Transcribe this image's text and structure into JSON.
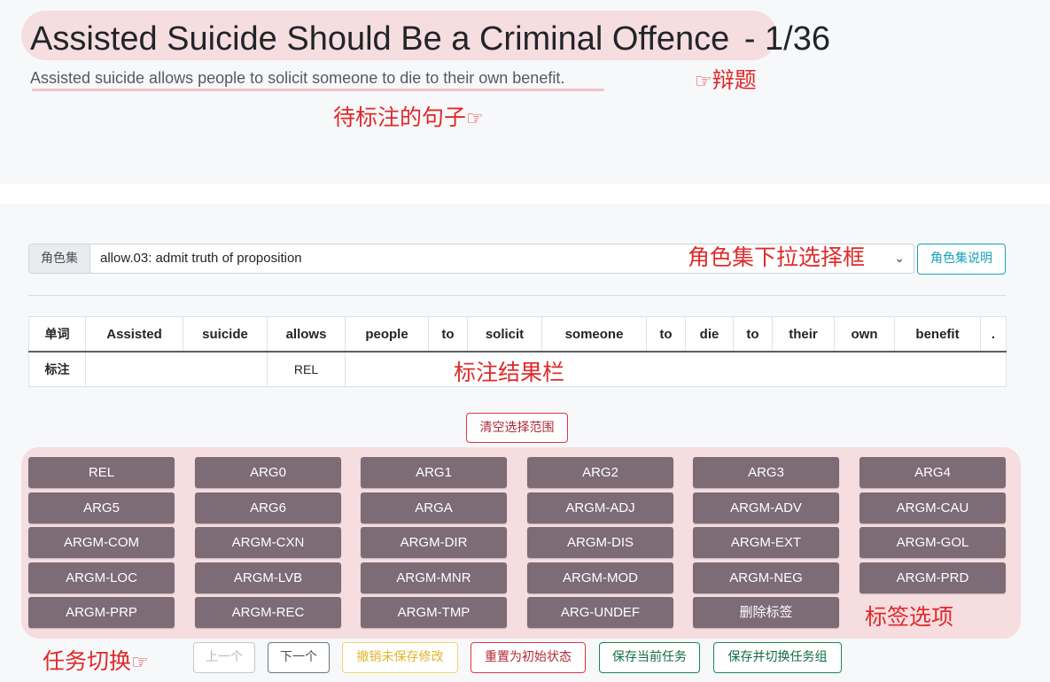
{
  "page": {
    "title": "Assisted Suicide Should Be a Criminal Offence",
    "counter": "- 1/36",
    "sentence": "Assisted suicide allows people to solicit someone to die to their own benefit."
  },
  "annotations": {
    "topic": "辩题",
    "sentence": "待标注的句子",
    "roleset_dropdown": "角色集下拉选择框",
    "result_bar": "标注结果栏",
    "label_options": "标签选项",
    "task_switch": "任务切换",
    "hand_icon": "☞",
    "color": "#e02a2a"
  },
  "roleset": {
    "label": "角色集",
    "selected": "allow.03: admit truth of proposition",
    "chevron": "⌄",
    "help_button": "角色集说明"
  },
  "table": {
    "header_label": "单词",
    "words": [
      "Assisted",
      "suicide",
      "allows",
      "people",
      "to",
      "solicit",
      "someone",
      "to",
      "die",
      "to",
      "their",
      "own",
      "benefit",
      "."
    ],
    "row_label": "标注",
    "tags": [
      {
        "text": ""
      },
      {
        "text": "REL"
      },
      {
        "text": ""
      }
    ]
  },
  "clear_button": "清空选择范围",
  "labels": [
    "REL",
    "ARG0",
    "ARG1",
    "ARG2",
    "ARG3",
    "ARG4",
    "ARG5",
    "ARG6",
    "ARGA",
    "ARGM-ADJ",
    "ARGM-ADV",
    "ARGM-CAU",
    "ARGM-COM",
    "ARGM-CXN",
    "ARGM-DIR",
    "ARGM-DIS",
    "ARGM-EXT",
    "ARGM-GOL",
    "ARGM-LOC",
    "ARGM-LVB",
    "ARGM-MNR",
    "ARGM-MOD",
    "ARGM-NEG",
    "ARGM-PRD",
    "ARGM-PRP",
    "ARGM-REC",
    "ARGM-TMP",
    "ARG-UNDEF",
    "删除标签"
  ],
  "nav": {
    "prev": "上一个",
    "next": "下一个",
    "undo": "撤销未保存修改",
    "reset": "重置为初始状态",
    "save": "保存当前任务",
    "save_switch": "保存并切换任务组"
  },
  "colors": {
    "highlight": "#f6dde0",
    "label_button": "#7d6b76",
    "info": "#17a2b8",
    "danger": "#dc3545",
    "warning": "#ffc107",
    "success": "#198754",
    "secondary": "#6c757d"
  }
}
